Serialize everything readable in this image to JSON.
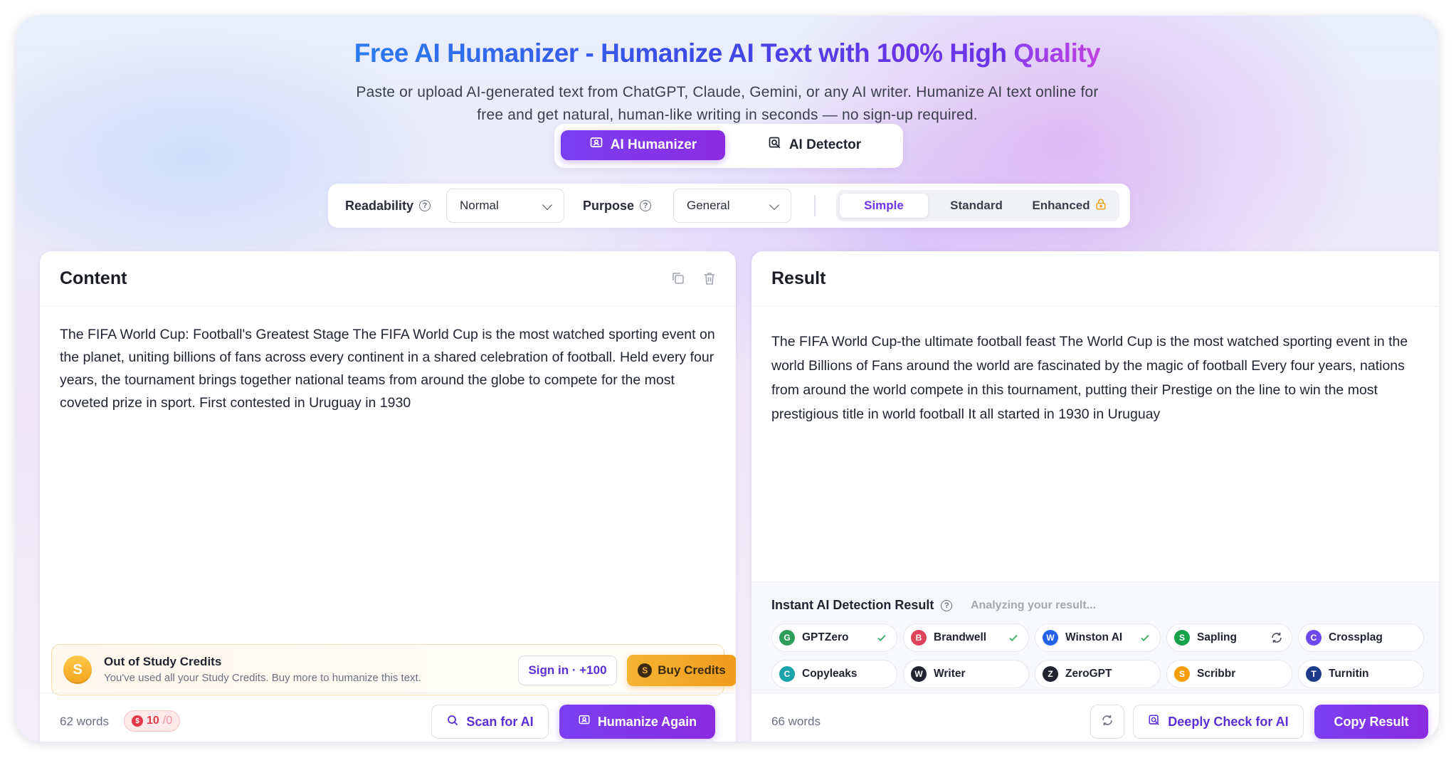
{
  "header": {
    "title_main": "Free AI Humanizer - Humanize AI Text with 100% High",
    "title_accent": "Quality",
    "subtitle_line1": "Paste or upload AI-generated text from ChatGPT, Claude, Gemini, or any AI writer. Humanize AI text online for",
    "subtitle_line2": "free and get natural, human-like writing in seconds — no sign-up required."
  },
  "modes": {
    "humanizer_label": "AI Humanizer",
    "detector_label": "AI Detector",
    "active": "AI Humanizer"
  },
  "options": {
    "readability_label": "Readability",
    "readability_value": "Normal",
    "purpose_label": "Purpose",
    "purpose_value": "General",
    "levels": [
      "Simple",
      "Standard",
      "Enhanced"
    ],
    "selected_level": "Simple"
  },
  "content_panel": {
    "title": "Content",
    "text": "The FIFA World Cup: Football's Greatest Stage The FIFA World Cup is the most watched sporting event on the planet, uniting billions of fans across every continent in a shared celebration of football. Held every four years, the tournament brings together national teams from around the globe to compete for the most coveted prize in sport. First contested in Uruguay in 1930",
    "word_count": "62 words",
    "credits_value": "10",
    "credits_suffix": "/0",
    "scan_label": "Scan for AI",
    "humanize_label": "Humanize Again"
  },
  "credits_banner": {
    "coin_letter": "S",
    "title": "Out of Study Credits",
    "message": "You've used all your Study Credits. Buy more to humanize this text.",
    "signin_label": "Sign in · +100",
    "buy_label": "Buy Credits",
    "buy_coin": "S"
  },
  "result_panel": {
    "title": "Result",
    "text": "The FIFA World Cup-the ultimate football feast The World Cup is the most watched sporting event in the world Billions of Fans around the world are fascinated by the magic of football Every four years, nations from around the world compete in this tournament, putting their Prestige on the line to win the most prestigious title in world football It all started in 1930 in Uruguay",
    "word_count": "66 words",
    "deep_check_label": "Deeply Check for AI",
    "copy_label": "Copy Result"
  },
  "detection": {
    "title": "Instant AI Detection Result",
    "status": "Analyzing your result...",
    "detectors": [
      {
        "name": "GPTZero",
        "letter": "G",
        "color": "#2f9e5b",
        "state": "check-icon"
      },
      {
        "name": "Brandwell",
        "letter": "B",
        "color": "#e0445c",
        "state": "check-icon"
      },
      {
        "name": "Winston AI",
        "letter": "W",
        "color": "#2563eb",
        "state": "check-icon"
      },
      {
        "name": "Sapling",
        "letter": "S",
        "color": "#16a34a",
        "state": "refresh-icon"
      },
      {
        "name": "Crossplag",
        "letter": "C",
        "color": "#6d4af0",
        "state": "none"
      },
      {
        "name": "Copyleaks",
        "letter": "C",
        "color": "#1aa3a8",
        "state": "none"
      },
      {
        "name": "Writer",
        "letter": "W",
        "color": "#1f2430",
        "state": "none"
      },
      {
        "name": "ZeroGPT",
        "letter": "Z",
        "color": "#1f2430",
        "state": "none"
      },
      {
        "name": "Scribbr",
        "letter": "S",
        "color": "#f59e0b",
        "state": "none"
      },
      {
        "name": "Turnitin",
        "letter": "T",
        "color": "#1e3a8a",
        "state": "none"
      }
    ]
  },
  "colors": {
    "accent_purple": "#7b3ff2",
    "title_blue": "#3d48e6",
    "buy_orange": "#f09b1c",
    "credit_red": "#e23a4a"
  }
}
